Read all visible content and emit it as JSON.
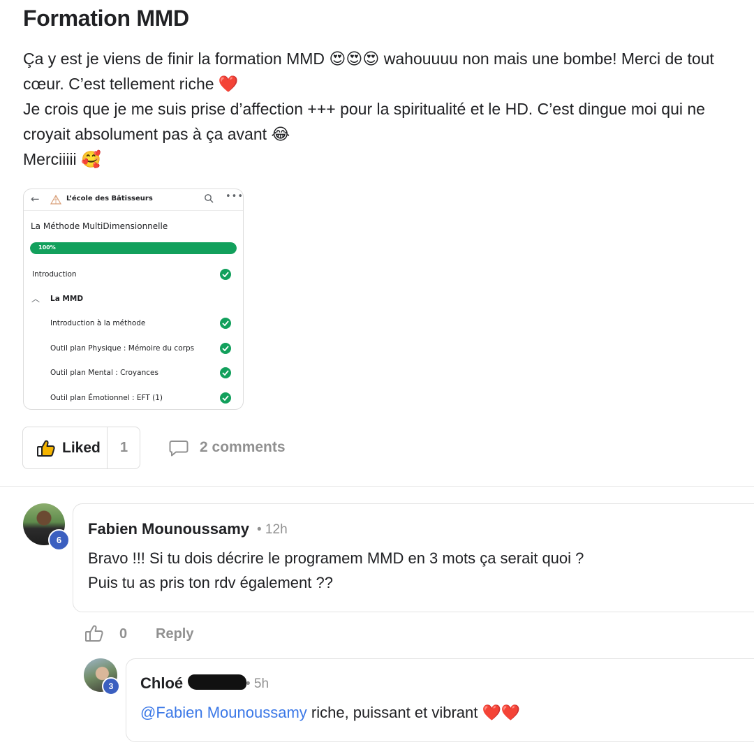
{
  "post": {
    "title": "Formation MMD",
    "paragraphs": [
      "Ça y est je viens de finir la formation MMD 😍😍😍 wahouuuu non mais une bombe! Merci de tout cœur. C’est tellement riche ❤️",
      "Je crois que je me suis prise d’affection +++ pour la spiritualité et le HD. C’est dingue moi qui ne croyait absolument pas à ça avant 😂",
      "Merciiiii 🥰"
    ]
  },
  "screenshot": {
    "app_name": "L’école des Bâtisseurs",
    "course_title": "La Méthode MultiDimensionnelle",
    "progress_label": "100%",
    "progress_fraction": 1.0,
    "items": [
      {
        "label": "Introduction",
        "completed": true
      },
      {
        "label": "La MMD",
        "completed": false
      },
      {
        "label": "Introduction à la méthode",
        "completed": true
      },
      {
        "label": "Outil plan Physique : Mémoire du corps",
        "completed": true
      },
      {
        "label": "Outil plan Mental : Croyances",
        "completed": true
      },
      {
        "label": "Outil plan Émotionnel : EFT (1)",
        "completed": true
      }
    ]
  },
  "actions": {
    "like_label": "Liked",
    "like_count": "1",
    "comments_label": "2 comments"
  },
  "comments": [
    {
      "author": "Fabien Mounoussamy",
      "time": "• 12h",
      "level": "6",
      "lines": [
        "Bravo !!! Si tu dois décrire le programem MMD en 3 mots ça serait quoi ?",
        "Puis tu as pris ton rdv également ??"
      ],
      "like_count": "0",
      "reply_label": "Reply"
    },
    {
      "author": "Chloé",
      "time": "• 5h",
      "level": "3",
      "mention": "@Fabien Mounoussamy",
      "text": " riche, puissant et vibrant ❤️❤️"
    }
  ],
  "colors": {
    "accent_green": "#12a05c",
    "level_badge": "#3b5fc0",
    "mention": "#3b78e7",
    "muted": "#909090"
  }
}
